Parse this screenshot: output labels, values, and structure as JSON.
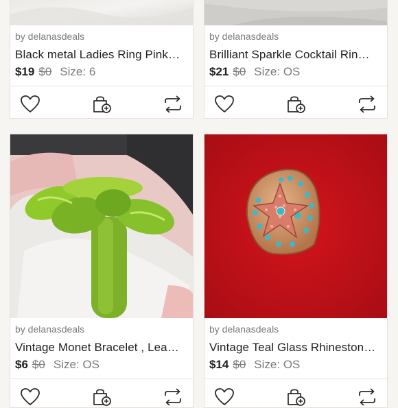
{
  "listings": [
    {
      "seller": "by delanasdeals",
      "title": "Black metal Ladies Ring Pink…",
      "price": "$19",
      "original_price": "$0",
      "size": "Size: 6",
      "image": "white-fabric-background"
    },
    {
      "seller": "by delanasdeals",
      "title": "Brilliant Sparkle Cocktail Rin…",
      "price": "$21",
      "original_price": "$0",
      "size": "Size: OS",
      "image": "grey-background"
    },
    {
      "seller": "by delanasdeals",
      "title": "Vintage Monet Bracelet , Lea…",
      "price": "$6",
      "original_price": "$0",
      "size": "Size: OS",
      "image": "green-flower-ring-on-glove"
    },
    {
      "seller": "by delanasdeals",
      "title": "Vintage Teal Glass Rhineston…",
      "price": "$14",
      "original_price": "$0",
      "size": "Size: OS",
      "image": "starfish-rhinestone-ring-on-red"
    }
  ],
  "icons": {
    "like": "heart-icon",
    "bundle": "shopping-bag-plus-icon",
    "share": "share-repost-icon"
  },
  "colors": {
    "background": "#f7f5f2",
    "text": "#1f1f1f",
    "muted": "#7d7a78",
    "red_backdrop": "#c8101a",
    "green_ring": "#8fca2a"
  }
}
